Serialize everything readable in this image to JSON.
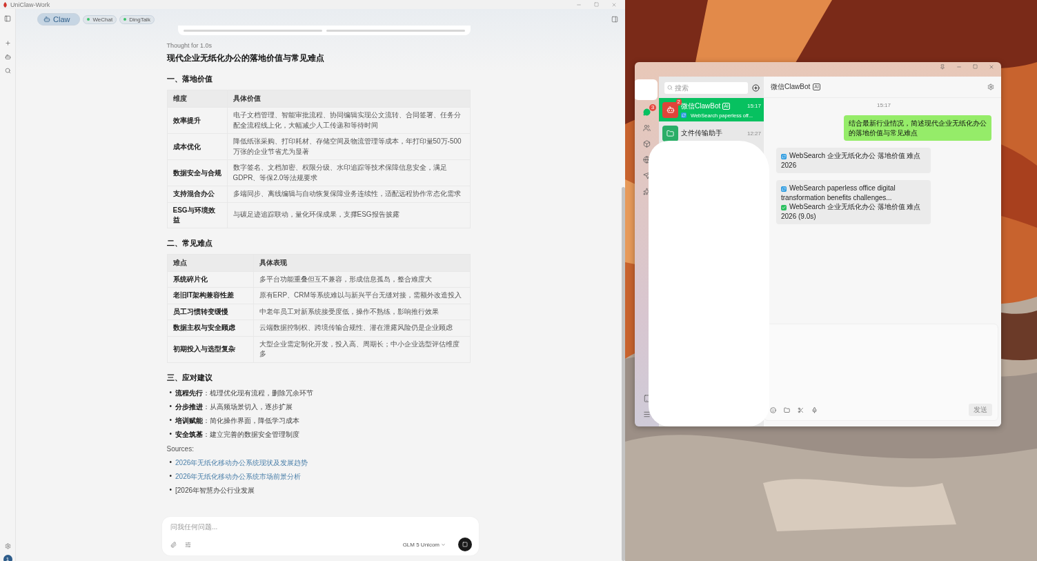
{
  "app": {
    "title": "UniClaw-Work",
    "user_badge": "1"
  },
  "agent_tabs": [
    {
      "label": "Claw",
      "kind": "agent",
      "selected": true
    },
    {
      "label": "WeChat",
      "kind": "channel",
      "selected": false
    },
    {
      "label": "DingTalk",
      "kind": "channel",
      "selected": false
    }
  ],
  "answer": {
    "thought": "Thought for 1.0s",
    "title": "现代企业无纸化办公的落地价值与常见难点",
    "sections": [
      {
        "kind": "table",
        "heading": "一、落地价值",
        "columns": [
          "维度",
          "具体价值"
        ],
        "rows": [
          {
            "name": "效率提升",
            "detail": "电子文档管理、智能审批流程、协同编辑实现公文流转、合同签署、任务分配全流程线上化，大幅减少人工传递和等待时间"
          },
          {
            "name": "成本优化",
            "detail": "降低纸张采购、打印耗材、存储空间及物流管理等成本，年打印量50万-500万张的企业节省尤为显著"
          },
          {
            "name": "数据安全与合规",
            "detail": "数字签名、文档加密、权限分级、水印追踪等技术保障信息安全，满足GDPR、等保2.0等法规要求"
          },
          {
            "name": "支持混合办公",
            "detail": "多端同步、离线编辑与自动恢复保障业务连续性，适配远程协作常态化需求"
          },
          {
            "name": "ESG与环境效益",
            "detail": "与碳足迹追踪联动，量化环保成果，支撑ESG报告披露"
          }
        ]
      },
      {
        "kind": "table",
        "heading": "二、常见难点",
        "columns": [
          "难点",
          "具体表现"
        ],
        "rows": [
          {
            "name": "系统碎片化",
            "detail": "多平台功能重叠但互不兼容，形成信息孤岛，整合难度大"
          },
          {
            "name": "老旧IT架构兼容性差",
            "detail": "原有ERP、CRM等系统难以与新兴平台无缝对接，需额外改造投入"
          },
          {
            "name": "员工习惯转变缓慢",
            "detail": "中老年员工对新系统接受度低，操作不熟练，影响推行效果"
          },
          {
            "name": "数据主权与安全顾虑",
            "detail": "云端数据控制权、跨境传输合规性、潜在泄露风险仍是企业顾虑"
          },
          {
            "name": "初期投入与选型复杂",
            "detail": "大型企业需定制化开发，投入高、周期长；中小企业选型评估维度多"
          }
        ]
      },
      {
        "kind": "list",
        "heading": "三、应对建议",
        "bullet": "•",
        "items": [
          "**流程先行**：梳理优化现有流程，删除冗余环节",
          "**分步推进**：从高频场景切入，逐步扩展",
          "**培训赋能**：简化操作界面，降低学习成本",
          "**安全筑基**：建立完善的数据安全管理制度"
        ]
      }
    ],
    "sources_label": "Sources:",
    "sources_bullet": "•",
    "sources": [
      {
        "text": "2026年无纸化移动办公系统现状及发展趋势",
        "kind": "link"
      },
      {
        "text": "2026年无纸化移动办公系统市场前景分析",
        "kind": "link"
      },
      {
        "text": "[2026年智慧办公行业发展",
        "kind": "plain"
      }
    ]
  },
  "composer": {
    "placeholder": "问我任何问题...",
    "model": "GLM 5 Unicom"
  },
  "wechat": {
    "nav_badge": "3",
    "search_placeholder": "搜索",
    "chats": [
      {
        "name": "微信ClawBot",
        "tag": "AI",
        "time": "15:17",
        "preview": "WebSearch paperless off...",
        "badge": "2",
        "selected": true,
        "kind": "bot"
      },
      {
        "name": "文件传输助手",
        "time": "12:27",
        "selected": false,
        "kind": "file"
      }
    ],
    "chat_title": "微信ClawBot",
    "chat_tag": "AI",
    "time": "15:17",
    "messages": [
      {
        "kind": "outgoing",
        "text": "结合最新行业情况，简述现代企业无纸化办公的落地价值与常见难点"
      },
      {
        "kind": "tool",
        "lines": [
          {
            "done": false,
            "text": "WebSearch 企业无纸化办公 落地价值 难点 2026"
          }
        ]
      },
      {
        "kind": "tool",
        "lines": [
          {
            "done": false,
            "text": "WebSearch paperless office digital transformation benefits challenges..."
          },
          {
            "done": true,
            "text": "WebSearch 企业无纸化办公 落地价值 难点 2026 (9.0s)"
          }
        ]
      }
    ],
    "send": {
      "label": "发送",
      "disabled": true
    }
  }
}
